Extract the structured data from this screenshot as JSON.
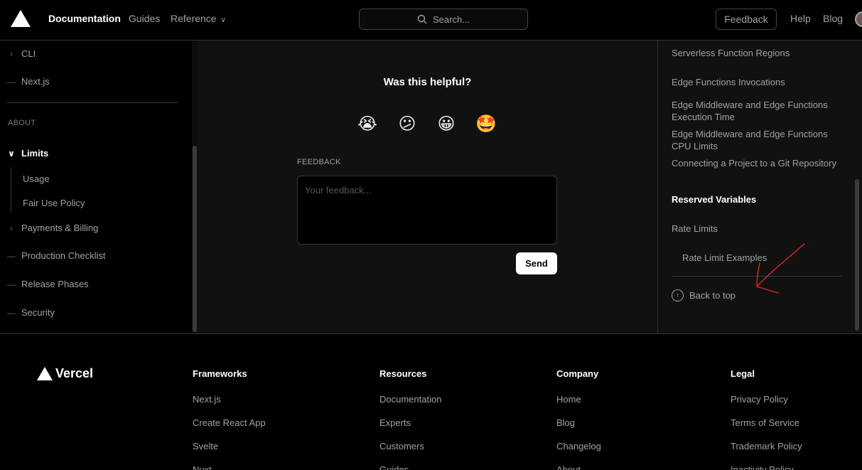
{
  "header": {
    "nav": [
      {
        "label": "Documentation",
        "active": true
      },
      {
        "label": "Guides",
        "active": false
      },
      {
        "label": "Reference",
        "active": false
      }
    ],
    "search_placeholder": "Search...",
    "feedback_label": "Feedback",
    "help_label": "Help",
    "blog_label": "Blog"
  },
  "sidebar": {
    "items_top": [
      {
        "label": "CLI",
        "mark": "chevron-right"
      },
      {
        "label": "Next.js",
        "mark": "dash"
      }
    ],
    "section_label": "ABOUT",
    "limits_label": "Limits",
    "limits_children": [
      "Usage",
      "Fair Use Policy"
    ],
    "items_bottom": [
      {
        "label": "Payments & Billing",
        "mark": "chevron-right"
      },
      {
        "label": "Production Checklist",
        "mark": "dash"
      },
      {
        "label": "Release Phases",
        "mark": "dash"
      },
      {
        "label": "Security",
        "mark": "dash"
      }
    ]
  },
  "main": {
    "helpful_title": "Was this helpful?",
    "emojis": [
      "😭",
      "😕",
      "😀",
      "🤩"
    ],
    "feedback_label": "FEEDBACK",
    "feedback_placeholder": "Your feedback...",
    "send_label": "Send"
  },
  "toc": {
    "items": [
      {
        "label": "Serverless Function Regions",
        "bold": false
      },
      {
        "label": "Edge Functions Invocations",
        "bold": false
      },
      {
        "label": "Edge Middleware and Edge Functions Execution Time",
        "bold": false
      },
      {
        "label": "Edge Middleware and Edge Functions CPU Limits",
        "bold": false
      },
      {
        "label": "Connecting a Project to a Git Repository",
        "bold": false
      },
      {
        "label": "Reserved Variables",
        "bold": true
      },
      {
        "label": "Rate Limits",
        "bold": false
      },
      {
        "label": "Rate Limit Examples",
        "bold": false
      }
    ],
    "back_to_top": "Back to top",
    "annotation_color": "#e3242b"
  },
  "footer": {
    "brand": "Vercel",
    "columns": [
      {
        "title": "Frameworks",
        "links": [
          "Next.js",
          "Create React App",
          "Svelte",
          "Nuxt"
        ]
      },
      {
        "title": "Resources",
        "links": [
          "Documentation",
          "Experts",
          "Customers",
          "Guides"
        ]
      },
      {
        "title": "Company",
        "links": [
          "Home",
          "Blog",
          "Changelog",
          "About"
        ]
      },
      {
        "title": "Legal",
        "links": [
          "Privacy Policy",
          "Terms of Service",
          "Trademark Policy",
          "Inactivity Policy"
        ]
      }
    ]
  }
}
